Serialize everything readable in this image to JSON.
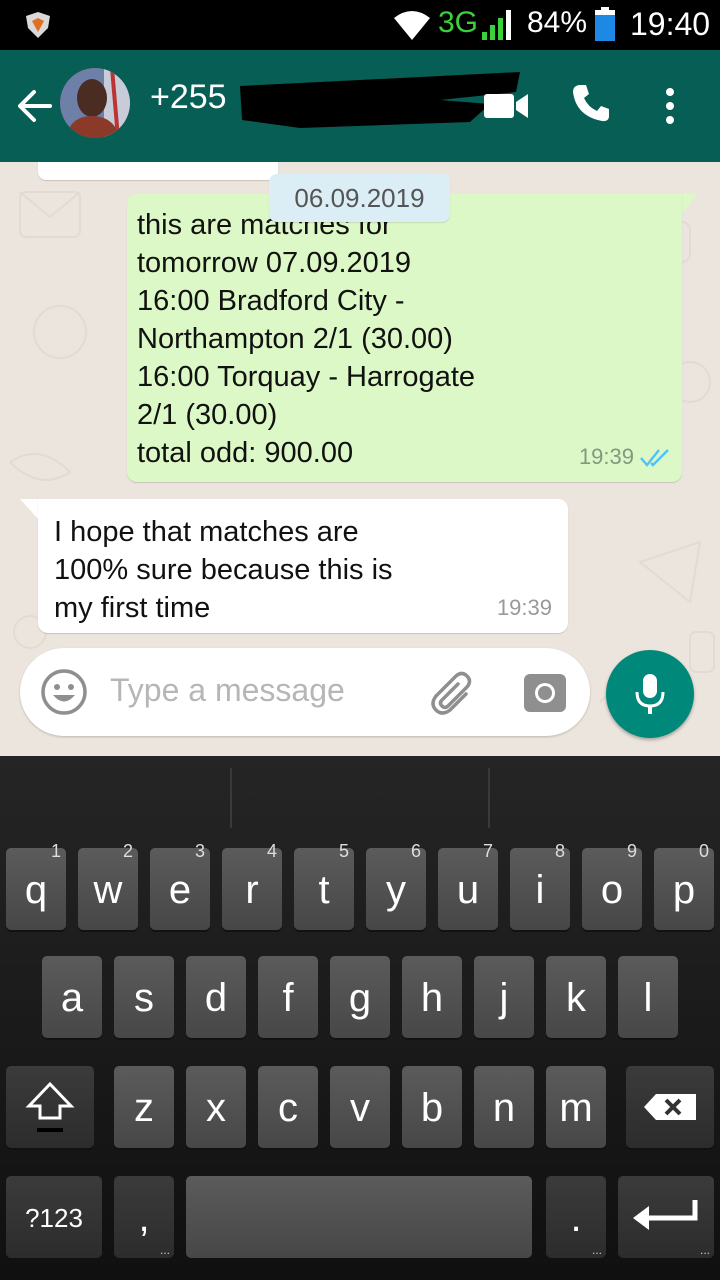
{
  "status_bar": {
    "network": "3G",
    "battery": "84%",
    "time": "19:40"
  },
  "header": {
    "contact_prefix": "+255"
  },
  "chat": {
    "date_chip": "06.09.2019",
    "outgoing": {
      "text": "this are matches for\ntomorrow 07.09.2019\n16:00 Bradford City -\nNorthampton  2/1  (30.00)\n16:00 Torquay - Harrogate\n2/1  (30.00)\ntotal odd: 900.00",
      "time": "19:39"
    },
    "incoming": {
      "text": "I hope that matches are\n100% sure because this is\nmy first time",
      "time": "19:39"
    }
  },
  "input": {
    "placeholder": "Type a message"
  },
  "keyboard": {
    "row1": [
      {
        "k": "q",
        "h": "1"
      },
      {
        "k": "w",
        "h": "2"
      },
      {
        "k": "e",
        "h": "3"
      },
      {
        "k": "r",
        "h": "4"
      },
      {
        "k": "t",
        "h": "5"
      },
      {
        "k": "y",
        "h": "6"
      },
      {
        "k": "u",
        "h": "7"
      },
      {
        "k": "i",
        "h": "8"
      },
      {
        "k": "o",
        "h": "9"
      },
      {
        "k": "p",
        "h": "0"
      }
    ],
    "row2": [
      "a",
      "s",
      "d",
      "f",
      "g",
      "h",
      "j",
      "k",
      "l"
    ],
    "row3": [
      "z",
      "x",
      "c",
      "v",
      "b",
      "n",
      "m"
    ],
    "symbols": "?123",
    "comma": ",",
    "period": "."
  },
  "icons": [
    "shield-app-icon",
    "wifi-icon",
    "signal-icon",
    "battery-icon",
    "back-arrow-icon",
    "video-call-icon",
    "phone-icon",
    "more-vert-icon",
    "double-tick-icon",
    "emoji-icon",
    "attach-icon",
    "camera-icon",
    "mic-icon",
    "shift-icon",
    "backspace-icon",
    "enter-icon"
  ],
  "colors": {
    "header": "#075e54",
    "outgoing_bubble": "#dcf8c6",
    "mic_button": "#00897b",
    "date_chip": "#dbeef6"
  }
}
